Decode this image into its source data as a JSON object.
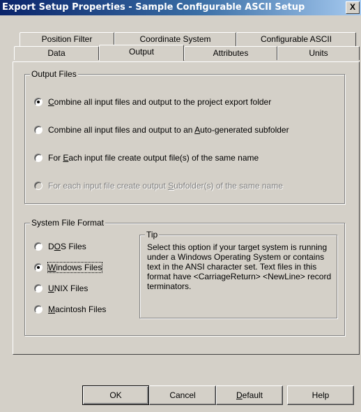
{
  "window": {
    "title": "Export Setup Properties - Sample Configurable ASCII Setup",
    "close_glyph": "X"
  },
  "tabs": {
    "row1": [
      "Position Filter",
      "Coordinate System",
      "Configurable ASCII"
    ],
    "row2": [
      "Data",
      "Output",
      "Attributes",
      "Units"
    ],
    "active": "Output"
  },
  "output_files": {
    "legend": "Output Files",
    "options": [
      {
        "pre": "",
        "key": "C",
        "post": "ombine all input files and output to the project export folder",
        "selected": true,
        "enabled": true
      },
      {
        "pre": "Combine all input files and output to an ",
        "key": "A",
        "post": "uto-generated subfolder",
        "selected": false,
        "enabled": true
      },
      {
        "pre": "For ",
        "key": "E",
        "post": "ach input file create output file(s) of the same name",
        "selected": false,
        "enabled": true
      },
      {
        "pre": "For each input file create output ",
        "key": "S",
        "post": "ubfolder(s) of the same name",
        "selected": false,
        "enabled": false
      }
    ]
  },
  "system_file_format": {
    "legend": "System File Format",
    "options": [
      {
        "pre": "D",
        "key": "O",
        "post": "S Files",
        "selected": false
      },
      {
        "pre": "",
        "key": "W",
        "post": "indows Files",
        "selected": true
      },
      {
        "pre": "",
        "key": "U",
        "post": "NIX Files",
        "selected": false
      },
      {
        "pre": "",
        "key": "M",
        "post": "acintosh Files",
        "selected": false
      }
    ],
    "tip": {
      "legend": "Tip",
      "text": "Select this option if your target system is running under a Windows Operating System or contains text in the ANSI character set. Text files in this format have <CarriageReturn> <NewLine> record terminators."
    }
  },
  "buttons": {
    "ok": "OK",
    "cancel": "Cancel",
    "default_pre": "",
    "default_key": "D",
    "default_post": "efault",
    "help": "Help"
  }
}
